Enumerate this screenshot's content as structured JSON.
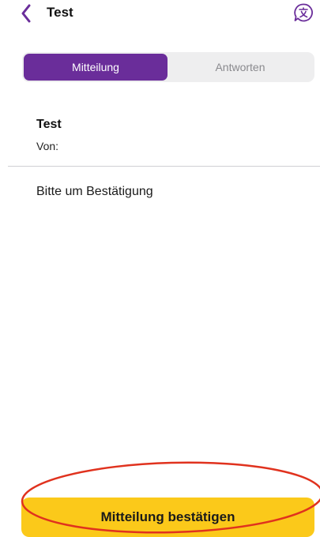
{
  "navbar": {
    "title": "Test",
    "back_icon": "chevron-left-icon",
    "translate_icon": "translate-bubble-icon",
    "accent_color": "#6a2d9a"
  },
  "tabs": [
    {
      "label": "Mitteilung",
      "active": true
    },
    {
      "label": "Antworten",
      "active": false
    }
  ],
  "message": {
    "title": "Test",
    "from_label": "Von:",
    "from_value": "",
    "body": "Bitte um Bestätigung"
  },
  "confirm_button": {
    "label": "Mitteilung bestätigen",
    "color": "#fbc91a"
  },
  "annotation": {
    "color": "#e0321e"
  }
}
